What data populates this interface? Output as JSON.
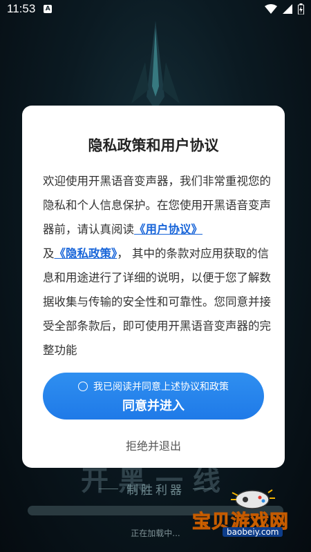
{
  "status_bar": {
    "time": "11:53",
    "app_icon_letter": "A",
    "icons": [
      "wifi-icon",
      "signal-icon",
      "battery-icon"
    ]
  },
  "background": {
    "logo_text": "开黑一线",
    "slogan": "制胜利器",
    "loading_text": "正在加载中...",
    "progress": 0.0
  },
  "watermark": {
    "title": "宝贝游戏网",
    "url": "baobeiy.com"
  },
  "dialog": {
    "title": "隐私政策和用户协议",
    "body_intro": "欢迎使用开黑语音变声器，我们非常重视您的隐私和个人信息保护。在您使用开黑语音变声器前，请认真阅读",
    "user_agreement_link": "《用户协议》",
    "and_text": "及",
    "privacy_policy_link": "《隐私政策》",
    "body_rest": "， 其中的条款对应用获取的信息和用途进行了详细的说明，以便于您了解数据收集与传输的安全性和可靠性。您同意并接受全部条款后，即可使用开黑语音变声器的完整功能",
    "consent_text": "我已阅读并同意上述协议和政策",
    "agree_label": "同意并进入",
    "reject_label": "拒绝并退出"
  },
  "colors": {
    "accent": "#1f7ae8",
    "link": "#1a66d9",
    "watermark_yellow": "#f4b400"
  }
}
